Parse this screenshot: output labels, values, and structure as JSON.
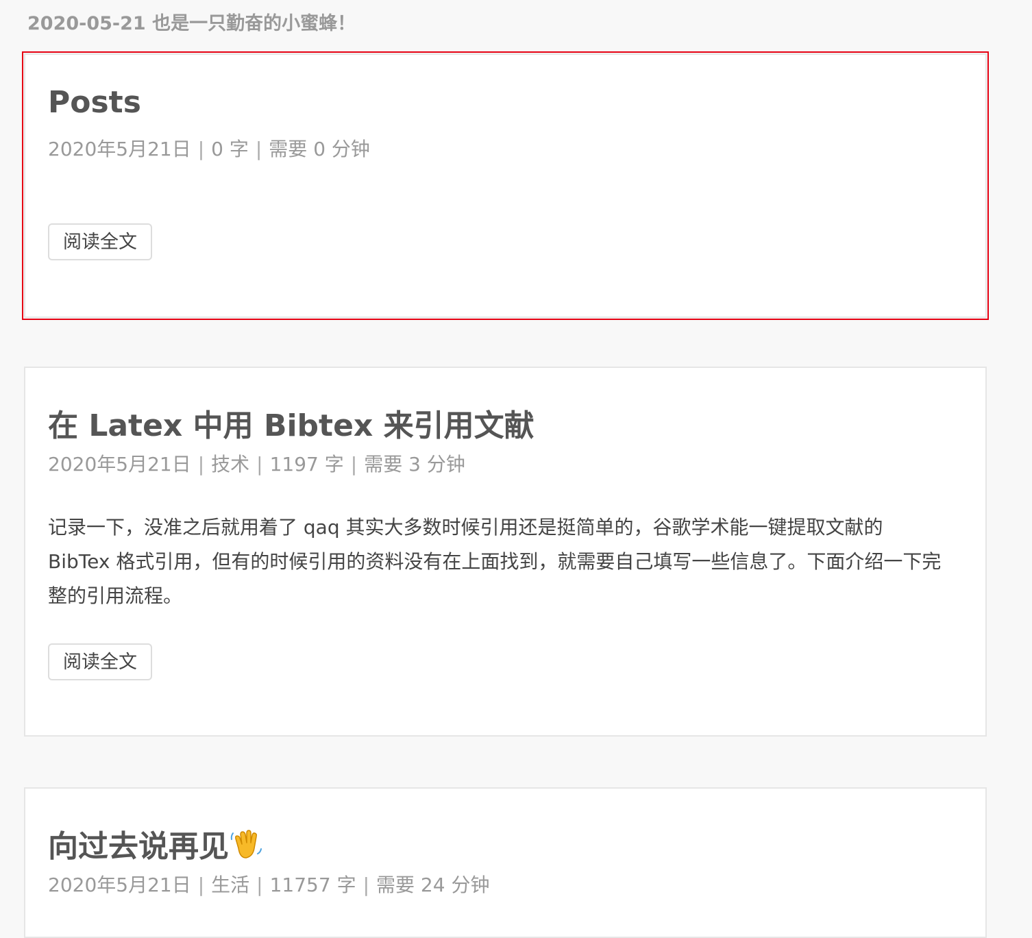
{
  "header": {
    "text": "2020-05-21 也是一只勤奋的小蜜蜂！"
  },
  "posts": [
    {
      "title": "Posts",
      "date": "2020年5月21日",
      "words": "0 字",
      "read_time": "需要 0 分钟",
      "read_more_label": "阅读全文"
    },
    {
      "title": "在 Latex 中用 Bibtex 来引用文献",
      "date": "2020年5月21日",
      "category": "技术",
      "words": "1197 字",
      "read_time": "需要 3 分钟",
      "excerpt": "记录一下，没准之后就用着了 qaq 其实大多数时候引用还是挺简单的，谷歌学术能一键提取文献的 BibTex 格式引用，但有的时候引用的资料没有在上面找到，就需要自己填写一些信息了。下面介绍一下完整的引用流程。",
      "read_more_label": "阅读全文"
    },
    {
      "title": "向过去说再见",
      "title_emoji": "waving-hand-emoji",
      "date": "2020年5月21日",
      "category": "生活",
      "words": "11757 字",
      "read_time": "需要 24 分钟"
    }
  ],
  "meta_separator": "|",
  "colors": {
    "highlight": "#e60012",
    "background": "#f8f8f8",
    "card": "#ffffff"
  }
}
